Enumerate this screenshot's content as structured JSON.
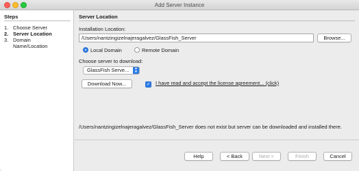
{
  "window": {
    "title": "Add Server Instance"
  },
  "steps": {
    "title": "Steps",
    "items": [
      {
        "num": "1.",
        "label": "Choose Server"
      },
      {
        "num": "2.",
        "label": "Server Location"
      },
      {
        "num": "3.",
        "label": "Domain Name/Location"
      }
    ]
  },
  "content": {
    "section_title": "Server Location",
    "install_label": "Installation Location:",
    "install_path": "/Users/nantzingizelnajeragalvez/GlassFish_Server",
    "browse_label": "Browse...",
    "local_domain_label": "Local Domain",
    "remote_domain_label": "Remote Domain",
    "choose_label": "Choose server to download:",
    "server_select": "GlassFish Serve...",
    "download_label": "Download Now...",
    "license_label": "I have read and accept the license agreement... (click)",
    "status_message": "/Users/nantzingizelnajeragalvez/GlassFish_Server does not exist but server can be downloaded and installed there."
  },
  "footer": {
    "help": "Help",
    "back": "< Back",
    "next": "Next >",
    "finish": "Finish",
    "cancel": "Cancel"
  },
  "icons": {
    "checkbox": "checkmark-icon",
    "select": "chevron-up-down-icon"
  },
  "colors": {
    "accent": "#2d7ce6",
    "close": "#fc5f57",
    "minimize": "#fdbc2e",
    "maximize": "#28c840"
  }
}
